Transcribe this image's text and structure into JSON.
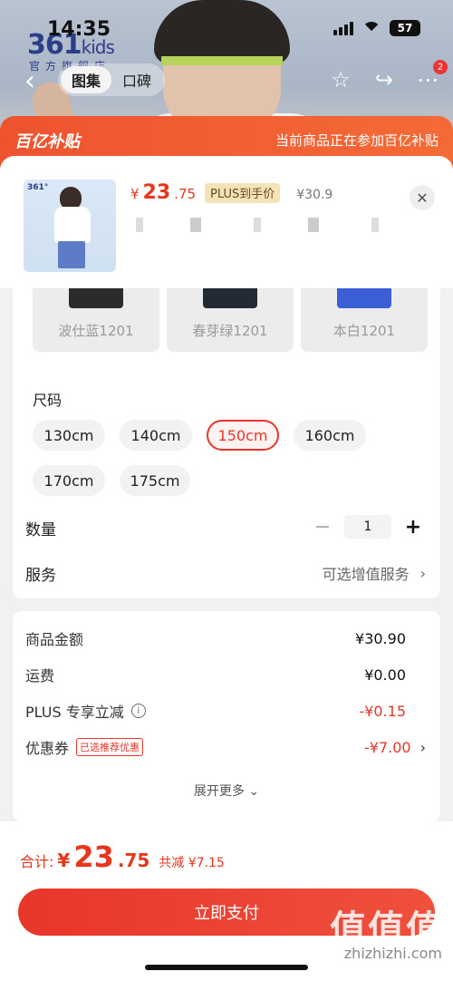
{
  "status": {
    "time": "14:35",
    "battery": "57"
  },
  "brand": {
    "logo": "361",
    "logo_suffix": "kids",
    "sub": "官方旗舰店"
  },
  "header": {
    "tabs": [
      {
        "label": "图集"
      },
      {
        "label": "口碑"
      }
    ],
    "cart_badge": "2"
  },
  "subsidy": {
    "logo": "百亿补贴",
    "text": "当前商品正在参加百亿补贴"
  },
  "product": {
    "price_currency": "¥",
    "price_int": "23",
    "price_dec": ".75",
    "plus_tag": "PLUS到手价",
    "original_price": "¥30.9",
    "close_label": "✕"
  },
  "colors": [
    {
      "label": "波仕蓝1201"
    },
    {
      "label": "春芽绿1201"
    },
    {
      "label": "本白1201"
    }
  ],
  "size": {
    "label": "尺码",
    "options": [
      {
        "label": "130cm"
      },
      {
        "label": "140cm"
      },
      {
        "label": "150cm"
      },
      {
        "label": "160cm"
      },
      {
        "label": "170cm"
      },
      {
        "label": "175cm"
      }
    ],
    "selected": "150cm"
  },
  "quantity": {
    "label": "数量",
    "value": "1",
    "minus": "−",
    "plus": "+"
  },
  "service": {
    "label": "服务",
    "value": "可选增值服务",
    "chevron": "›"
  },
  "summary": {
    "rows": [
      {
        "label": "商品金额",
        "value": "¥30.90"
      },
      {
        "label": "运费",
        "value": "¥0.00"
      },
      {
        "label": "PLUS 专享立减",
        "value": "-¥0.15"
      },
      {
        "label": "优惠券",
        "tag": "已选推荐优惠",
        "value": "-¥7.00"
      }
    ],
    "expand": "展开更多"
  },
  "total": {
    "label": "合计:",
    "currency": "¥",
    "int": "23",
    "dec": ".75",
    "saved": "共减 ¥7.15"
  },
  "pay_button": "立即支付",
  "watermark": {
    "text": "值值值",
    "sub": "zhizhizhi.com"
  },
  "colors_theme": {
    "accent": "#e8362a",
    "subsidy": "#ee5330"
  }
}
